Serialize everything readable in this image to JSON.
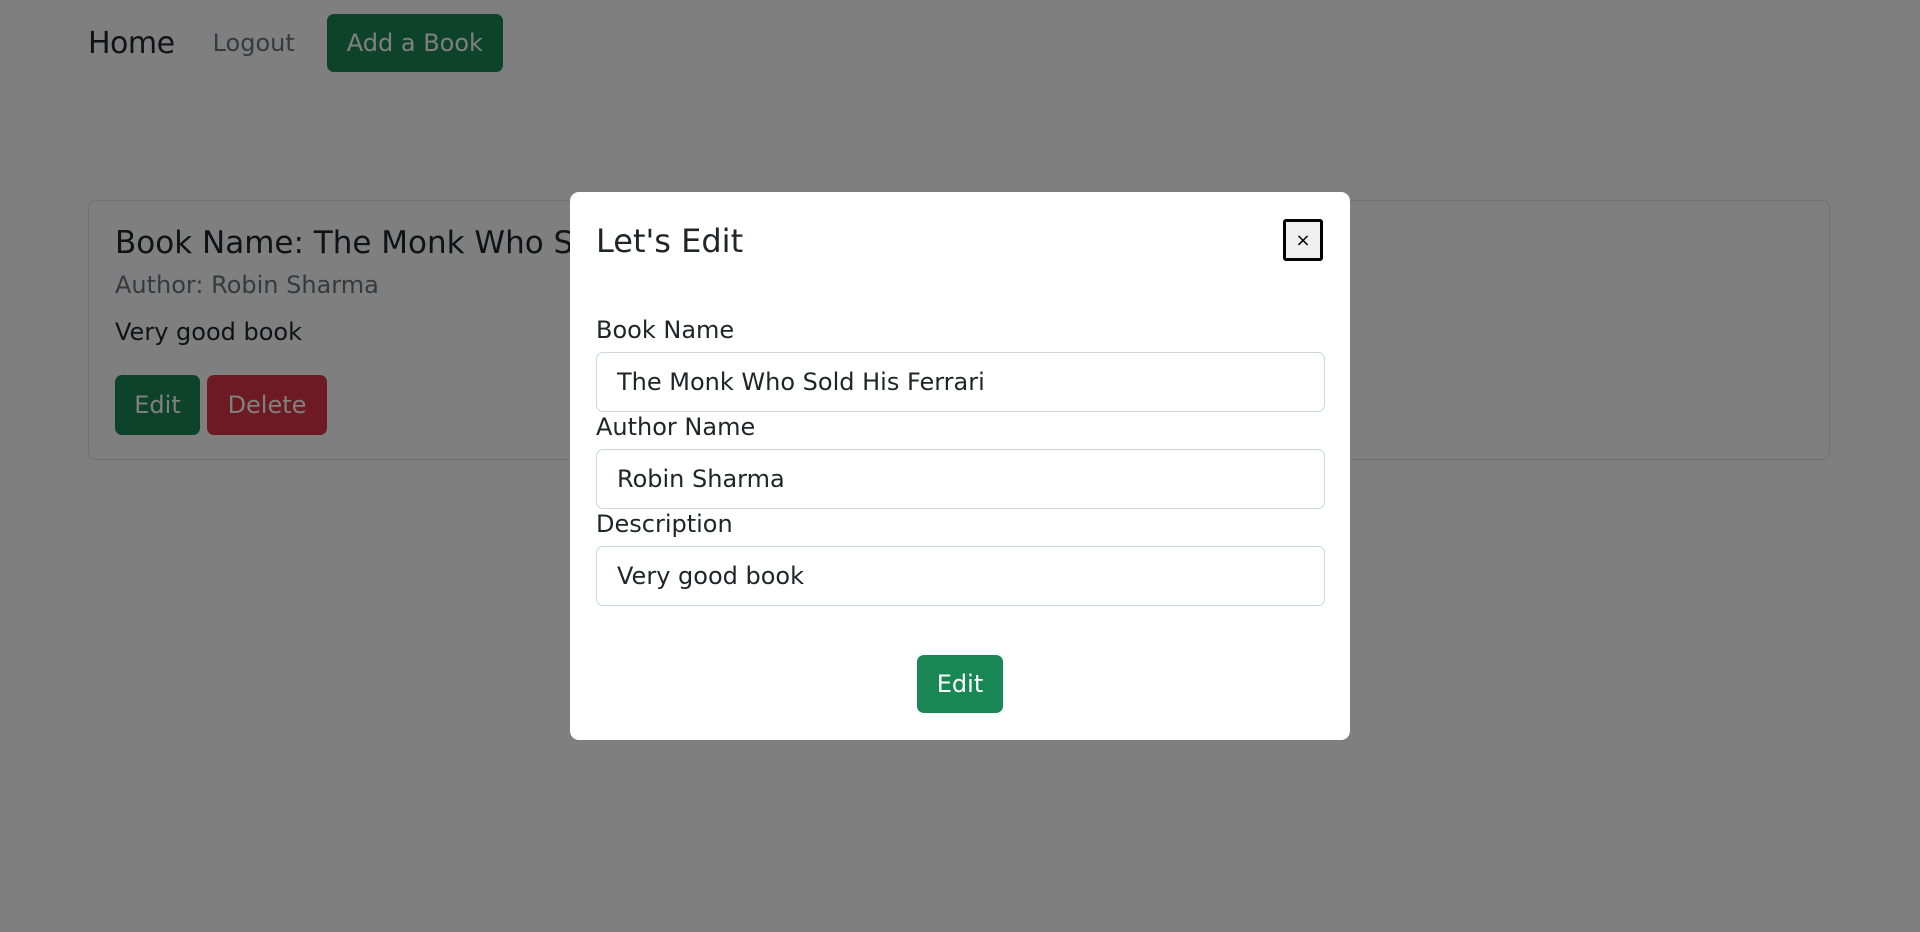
{
  "navbar": {
    "home": "Home",
    "logout": "Logout",
    "add_book": "Add a Book"
  },
  "book": {
    "title": "Book Name: The Monk Who Sold His Ferrari",
    "author": "Author: Robin Sharma",
    "description": "Very good book",
    "edit_label": "Edit",
    "delete_label": "Delete"
  },
  "modal": {
    "title": "Let's Edit",
    "close": "×",
    "book_name_label": "Book Name",
    "book_name_value": "The Monk Who Sold His Ferrari",
    "author_name_label": "Author Name",
    "author_name_value": "Robin Sharma",
    "description_label": "Description",
    "description_value": "Very good book",
    "submit_label": "Edit"
  },
  "colors": {
    "primary_green": "#198754",
    "danger_red": "#dc3545",
    "backdrop": "rgba(0,0,0,0.5)"
  }
}
